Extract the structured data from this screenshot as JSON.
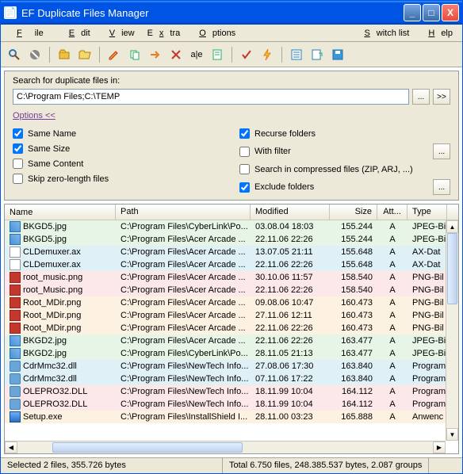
{
  "title": "EF Duplicate Files Manager",
  "menu": [
    "File",
    "Edit",
    "View",
    "Extra",
    "Options",
    "Switch list",
    "Help"
  ],
  "search": {
    "label": "Search for duplicate files in:",
    "path": "C:\\Program Files;C:\\TEMP",
    "options_link": "Options  <<",
    "left": [
      {
        "label": "Same Name",
        "checked": true
      },
      {
        "label": "Same Size",
        "checked": true
      },
      {
        "label": "Same Content",
        "checked": false
      },
      {
        "label": "Skip zero-length files",
        "checked": false
      }
    ],
    "right": [
      {
        "label": "Recurse folders",
        "checked": true,
        "dots": false
      },
      {
        "label": "With filter",
        "checked": false,
        "dots": true
      },
      {
        "label": "Search in compressed files (ZIP, ARJ, ...)",
        "checked": false,
        "dots": false
      },
      {
        "label": "Exclude folders",
        "checked": true,
        "dots": true
      }
    ]
  },
  "columns": [
    "Name",
    "Path",
    "Modified",
    "Size",
    "Att...",
    "Type"
  ],
  "rows": [
    {
      "g": 0,
      "i": "img",
      "n": "BKGD5.jpg",
      "p": "C:\\Program Files\\CyberLink\\Po...",
      "m": "03.08.04  18:03",
      "s": "155.244",
      "a": "A",
      "t": "JPEG-Bi"
    },
    {
      "g": 0,
      "i": "img",
      "n": "BKGD5.jpg",
      "p": "C:\\Program Files\\Acer Arcade ...",
      "m": "22.11.06  22:26",
      "s": "155.244",
      "a": "A",
      "t": "JPEG-Bi"
    },
    {
      "g": 1,
      "i": "ax",
      "n": "CLDemuxer.ax",
      "p": "C:\\Program Files\\Acer Arcade ...",
      "m": "13.07.05  21:11",
      "s": "155.648",
      "a": "A",
      "t": "AX-Dat"
    },
    {
      "g": 1,
      "i": "ax",
      "n": "CLDemuxer.ax",
      "p": "C:\\Program Files\\Acer Arcade ...",
      "m": "22.11.06  22:26",
      "s": "155.648",
      "a": "A",
      "t": "AX-Dat"
    },
    {
      "g": 2,
      "i": "png",
      "n": "root_music.png",
      "p": "C:\\Program Files\\Acer Arcade ...",
      "m": "30.10.06  11:57",
      "s": "158.540",
      "a": "A",
      "t": "PNG-Bil"
    },
    {
      "g": 2,
      "i": "png",
      "n": "root_Music.png",
      "p": "C:\\Program Files\\Acer Arcade ...",
      "m": "22.11.06  22:26",
      "s": "158.540",
      "a": "A",
      "t": "PNG-Bil"
    },
    {
      "g": 3,
      "i": "png",
      "n": "Root_MDir.png",
      "p": "C:\\Program Files\\Acer Arcade ...",
      "m": "09.08.06  10:47",
      "s": "160.473",
      "a": "A",
      "t": "PNG-Bil"
    },
    {
      "g": 3,
      "i": "png",
      "n": "Root_MDir.png",
      "p": "C:\\Program Files\\Acer Arcade ...",
      "m": "27.11.06  12:11",
      "s": "160.473",
      "a": "A",
      "t": "PNG-Bil"
    },
    {
      "g": 3,
      "i": "png",
      "n": "Root_MDir.png",
      "p": "C:\\Program Files\\Acer Arcade ...",
      "m": "22.11.06  22:26",
      "s": "160.473",
      "a": "A",
      "t": "PNG-Bil"
    },
    {
      "g": 4,
      "i": "img",
      "n": "BKGD2.jpg",
      "p": "C:\\Program Files\\Acer Arcade ...",
      "m": "22.11.06  22:26",
      "s": "163.477",
      "a": "A",
      "t": "JPEG-Bi"
    },
    {
      "g": 4,
      "i": "img",
      "n": "BKGD2.jpg",
      "p": "C:\\Program Files\\CyberLink\\Po...",
      "m": "28.11.05  21:13",
      "s": "163.477",
      "a": "A",
      "t": "JPEG-Bi"
    },
    {
      "g": 5,
      "i": "dll",
      "n": "CdrMmc32.dll",
      "p": "C:\\Program Files\\NewTech Info...",
      "m": "27.08.06  17:30",
      "s": "163.840",
      "a": "A",
      "t": "Program"
    },
    {
      "g": 5,
      "i": "dll",
      "n": "CdrMmc32.dll",
      "p": "C:\\Program Files\\NewTech Info...",
      "m": "07.11.06  17:22",
      "s": "163.840",
      "a": "A",
      "t": "Program"
    },
    {
      "g": 6,
      "i": "dll",
      "n": "OLEPRO32.DLL",
      "p": "C:\\Program Files\\NewTech Info...",
      "m": "18.11.99  10:04",
      "s": "164.112",
      "a": "A",
      "t": "Program"
    },
    {
      "g": 6,
      "i": "dll",
      "n": "OLEPRO32.DLL",
      "p": "C:\\Program Files\\NewTech Info...",
      "m": "18.11.99  10:04",
      "s": "164.112",
      "a": "A",
      "t": "Program"
    },
    {
      "g": 7,
      "i": "exe",
      "n": "Setup.exe",
      "p": "C:\\Program Files\\InstallShield I...",
      "m": "28.11.00  03:23",
      "s": "165.888",
      "a": "A",
      "t": "Anwenc"
    }
  ],
  "group_colors": [
    "#e6f5e6",
    "#dff0f7",
    "#fce8e8",
    "#fdf2e2",
    "#e6f5e6",
    "#dff0f7",
    "#fce8e8",
    "#fdf2e2"
  ],
  "status": {
    "left": "Selected 2 files, 355.726 bytes",
    "right": "Total 6.750 files, 248.385.537 bytes, 2.087 groups"
  }
}
